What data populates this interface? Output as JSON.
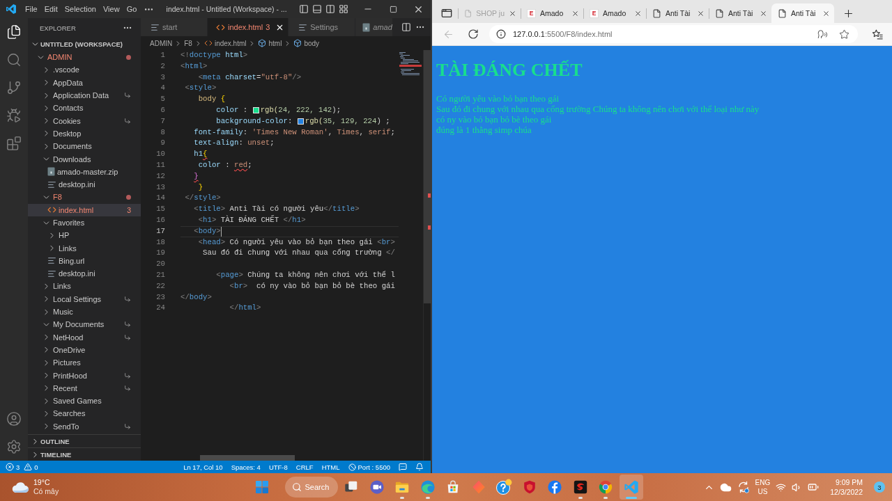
{
  "vscode": {
    "menu": [
      "File",
      "Edit",
      "Selection",
      "View",
      "Go"
    ],
    "title": "index.html - Untitled (Workspace) - ...",
    "activity_bar": [
      {
        "kind": "explorer",
        "selected": true
      },
      {
        "kind": "search",
        "selected": false
      },
      {
        "kind": "source-control",
        "selected": false
      },
      {
        "kind": "run-debug",
        "selected": false
      },
      {
        "kind": "extensions",
        "selected": false
      }
    ],
    "explorer": {
      "title": "EXPLORER",
      "workspace": {
        "label": "UNTITLED (WORKSPACE)",
        "expanded": true
      },
      "tree": [
        {
          "label": "ADMIN",
          "kind": "folder",
          "expanded": true,
          "error": true,
          "symlink": false,
          "selected": false,
          "children": [
            {
              "label": ".vscode",
              "kind": "folder",
              "expanded": false,
              "error": false,
              "symlink": false,
              "selected": false
            },
            {
              "label": "AppData",
              "kind": "folder",
              "expanded": false,
              "error": false,
              "symlink": false,
              "selected": false
            },
            {
              "label": "Application Data",
              "kind": "folder",
              "expanded": false,
              "error": false,
              "symlink": true,
              "selected": false
            },
            {
              "label": "Contacts",
              "kind": "folder",
              "expanded": false,
              "error": false,
              "symlink": false,
              "selected": false
            },
            {
              "label": "Cookies",
              "kind": "folder",
              "expanded": false,
              "error": false,
              "symlink": true,
              "selected": false
            },
            {
              "label": "Desktop",
              "kind": "folder",
              "expanded": false,
              "error": false,
              "symlink": false,
              "selected": false
            },
            {
              "label": "Documents",
              "kind": "folder",
              "expanded": false,
              "error": false,
              "symlink": false,
              "selected": false
            },
            {
              "label": "Downloads",
              "kind": "folder",
              "expanded": true,
              "error": false,
              "symlink": false,
              "selected": false,
              "children": [
                {
                  "label": "amado-master.zip",
                  "kind": "zip",
                  "error": false,
                  "symlink": false,
                  "selected": false
                },
                {
                  "label": "desktop.ini",
                  "kind": "text",
                  "error": false,
                  "symlink": false,
                  "selected": false
                }
              ]
            },
            {
              "label": "F8",
              "kind": "folder",
              "expanded": true,
              "error": true,
              "symlink": false,
              "selected": false,
              "children": [
                {
                  "label": "index.html",
                  "kind": "html",
                  "error": true,
                  "symlink": false,
                  "selected": true,
                  "problems": "3"
                }
              ]
            },
            {
              "label": "Favorites",
              "kind": "folder",
              "expanded": true,
              "error": false,
              "symlink": false,
              "selected": false,
              "children": [
                {
                  "label": "HP",
                  "kind": "folder",
                  "expanded": false,
                  "error": false,
                  "symlink": false,
                  "selected": false
                },
                {
                  "label": "Links",
                  "kind": "folder",
                  "expanded": false,
                  "error": false,
                  "symlink": false,
                  "selected": false
                },
                {
                  "label": "Bing.url",
                  "kind": "text",
                  "error": false,
                  "symlink": false,
                  "selected": false
                },
                {
                  "label": "desktop.ini",
                  "kind": "text",
                  "error": false,
                  "symlink": false,
                  "selected": false
                }
              ]
            },
            {
              "label": "Links",
              "kind": "folder",
              "expanded": false,
              "error": false,
              "symlink": false,
              "selected": false
            },
            {
              "label": "Local Settings",
              "kind": "folder",
              "expanded": false,
              "error": false,
              "symlink": true,
              "selected": false
            },
            {
              "label": "Music",
              "kind": "folder",
              "expanded": false,
              "error": false,
              "symlink": false,
              "selected": false
            },
            {
              "label": "My Documents",
              "kind": "folder",
              "expanded": true,
              "error": false,
              "symlink": true,
              "selected": false
            },
            {
              "label": "NetHood",
              "kind": "folder",
              "expanded": false,
              "error": false,
              "symlink": true,
              "selected": false
            },
            {
              "label": "OneDrive",
              "kind": "folder",
              "expanded": false,
              "error": false,
              "symlink": false,
              "selected": false
            },
            {
              "label": "Pictures",
              "kind": "folder",
              "expanded": false,
              "error": false,
              "symlink": false,
              "selected": false
            },
            {
              "label": "PrintHood",
              "kind": "folder",
              "expanded": false,
              "error": false,
              "symlink": true,
              "selected": false
            },
            {
              "label": "Recent",
              "kind": "folder",
              "expanded": false,
              "error": false,
              "symlink": true,
              "selected": false
            },
            {
              "label": "Saved Games",
              "kind": "folder",
              "expanded": false,
              "error": false,
              "symlink": false,
              "selected": false
            },
            {
              "label": "Searches",
              "kind": "folder",
              "expanded": false,
              "error": false,
              "symlink": false,
              "selected": false
            },
            {
              "label": "SendTo",
              "kind": "folder",
              "expanded": false,
              "error": false,
              "symlink": true,
              "selected": false
            }
          ]
        }
      ],
      "sections": [
        {
          "label": "OUTLINE",
          "expanded": false
        },
        {
          "label": "TIMELINE",
          "expanded": false
        }
      ]
    },
    "editor": {
      "tabs": [
        {
          "label": "start",
          "kind": "text",
          "selected": false,
          "error": false,
          "preview": false
        },
        {
          "label": "index.html",
          "kind": "html",
          "selected": true,
          "error": true,
          "preview": false,
          "problems": "3"
        },
        {
          "label": "Settings",
          "kind": "text",
          "selected": false,
          "error": false,
          "preview": false
        },
        {
          "label": "amad",
          "kind": "zip",
          "selected": false,
          "error": false,
          "preview": true
        }
      ],
      "breadcrumbs": [
        {
          "label": "ADMIN",
          "kind": "folder"
        },
        {
          "label": "F8",
          "kind": "folder"
        },
        {
          "label": "index.html",
          "kind": "html"
        },
        {
          "label": "html",
          "kind": "element"
        },
        {
          "label": "body",
          "kind": "element"
        }
      ],
      "lines": [
        {
          "number": "1",
          "active": false,
          "tokens": [
            {
              "kind": "punct",
              "text": "<!"
            },
            {
              "kind": "tag",
              "text": "doctype"
            },
            {
              "kind": "attr",
              "text": " html"
            },
            {
              "kind": "punct",
              "text": ">"
            }
          ]
        },
        {
          "number": "2",
          "active": false,
          "tokens": [
            {
              "kind": "punct",
              "text": "<"
            },
            {
              "kind": "tag",
              "text": "html"
            },
            {
              "kind": "punct",
              "text": ">"
            }
          ]
        },
        {
          "number": "3",
          "active": false,
          "tokens": [
            {
              "kind": "punct",
              "text": "    <"
            },
            {
              "kind": "tag",
              "text": "meta"
            },
            {
              "kind": "attr",
              "text": " charset"
            },
            {
              "kind": "text",
              "text": "="
            },
            {
              "kind": "string",
              "text": "\"utf-8\""
            },
            {
              "kind": "punct",
              "text": "/>"
            }
          ]
        },
        {
          "number": "4",
          "active": false,
          "tokens": [
            {
              "kind": "punct",
              "text": " <"
            },
            {
              "kind": "tag",
              "text": "style"
            },
            {
              "kind": "punct",
              "text": ">"
            }
          ]
        },
        {
          "number": "5",
          "active": false,
          "tokens": [
            {
              "kind": "selector",
              "text": "    body "
            },
            {
              "kind": "brace",
              "text": "{"
            }
          ]
        },
        {
          "number": "6",
          "active": false,
          "tokens": [
            {
              "kind": "prop",
              "text": "        color"
            },
            {
              "kind": "text",
              "text": " : "
            },
            {
              "kind": "swatch",
              "color": "#18de8e"
            },
            {
              "kind": "func",
              "text": "rgb("
            },
            {
              "kind": "number",
              "text": "24, 222, 142"
            },
            {
              "kind": "text",
              "text": ");"
            }
          ]
        },
        {
          "number": "7",
          "active": false,
          "tokens": [
            {
              "kind": "prop",
              "text": "        background-color"
            },
            {
              "kind": "text",
              "text": ": "
            },
            {
              "kind": "swatch",
              "color": "#2381e0"
            },
            {
              "kind": "func",
              "text": "rgb("
            },
            {
              "kind": "number",
              "text": "35, 129, 224"
            },
            {
              "kind": "text",
              "text": ") ;"
            }
          ]
        },
        {
          "number": "8",
          "active": false,
          "tokens": [
            {
              "kind": "prop",
              "text": "   font-family"
            },
            {
              "kind": "text",
              "text": ": "
            },
            {
              "kind": "string",
              "text": "'Times New Roman'"
            },
            {
              "kind": "text",
              "text": ", "
            },
            {
              "kind": "value",
              "text": "Times"
            },
            {
              "kind": "text",
              "text": ", "
            },
            {
              "kind": "value",
              "text": "serif"
            },
            {
              "kind": "text",
              "text": ";"
            }
          ]
        },
        {
          "number": "9",
          "active": false,
          "tokens": [
            {
              "kind": "prop",
              "text": "   text-align"
            },
            {
              "kind": "text",
              "text": ": "
            },
            {
              "kind": "value",
              "text": "unset"
            },
            {
              "kind": "text",
              "text": ";"
            }
          ]
        },
        {
          "number": "10",
          "active": false,
          "tokens": [
            {
              "kind": "prop",
              "text": "   h1"
            },
            {
              "kind": "brace-error",
              "text": "{"
            }
          ]
        },
        {
          "number": "11",
          "active": false,
          "tokens": [
            {
              "kind": "prop",
              "text": "    color"
            },
            {
              "kind": "text",
              "text": " : "
            },
            {
              "kind": "value-error",
              "text": "red"
            },
            {
              "kind": "text",
              "text": ";"
            }
          ]
        },
        {
          "number": "12",
          "active": false,
          "tokens": [
            {
              "kind": "unmatched",
              "text": "   }"
            }
          ]
        },
        {
          "number": "13",
          "active": false,
          "tokens": [
            {
              "kind": "brace",
              "text": "    }"
            }
          ]
        },
        {
          "number": "14",
          "active": false,
          "tokens": [
            {
              "kind": "punct",
              "text": " </"
            },
            {
              "kind": "tag",
              "text": "style"
            },
            {
              "kind": "punct",
              "text": ">"
            }
          ]
        },
        {
          "number": "15",
          "active": false,
          "tokens": [
            {
              "kind": "punct",
              "text": "   <"
            },
            {
              "kind": "tag",
              "text": "title"
            },
            {
              "kind": "punct",
              "text": ">"
            },
            {
              "kind": "text",
              "text": " Anti Tài có người yêu"
            },
            {
              "kind": "punct",
              "text": "</"
            },
            {
              "kind": "tag",
              "text": "title"
            },
            {
              "kind": "punct",
              "text": ">"
            }
          ]
        },
        {
          "number": "16",
          "active": false,
          "tokens": [
            {
              "kind": "punct",
              "text": "    <"
            },
            {
              "kind": "tag",
              "text": "h1"
            },
            {
              "kind": "punct",
              "text": ">"
            },
            {
              "kind": "text",
              "text": " TÀI ĐÁNG CHẾT "
            },
            {
              "kind": "punct",
              "text": "</"
            },
            {
              "kind": "tag",
              "text": "h1"
            },
            {
              "kind": "punct",
              "text": ">"
            }
          ]
        },
        {
          "number": "17",
          "active": true,
          "tokens": [
            {
              "kind": "punct",
              "text": "   <"
            },
            {
              "kind": "tag",
              "text": "body"
            },
            {
              "kind": "punct",
              "text": ">"
            }
          ]
        },
        {
          "number": "18",
          "active": false,
          "tokens": [
            {
              "kind": "punct",
              "text": "    <"
            },
            {
              "kind": "tag",
              "text": "head"
            },
            {
              "kind": "punct",
              "text": ">"
            },
            {
              "kind": "text",
              "text": " Có người yêu vào bỏ bạn theo gái "
            },
            {
              "kind": "punct",
              "text": "<"
            },
            {
              "kind": "tag",
              "text": "br"
            },
            {
              "kind": "punct",
              "text": ">"
            }
          ]
        },
        {
          "number": "19",
          "active": false,
          "tokens": [
            {
              "kind": "text",
              "text": "     Sau đó đi chung với nhau qua cổng trường "
            },
            {
              "kind": "punct",
              "text": "</"
            }
          ]
        },
        {
          "number": "20",
          "active": false
        },
        {
          "number": "21",
          "active": false,
          "tokens": [
            {
              "kind": "punct",
              "text": "        <"
            },
            {
              "kind": "tag",
              "text": "page"
            },
            {
              "kind": "punct",
              "text": ">"
            },
            {
              "kind": "text",
              "text": " Chúng ta không nên chơi với thể l"
            }
          ]
        },
        {
          "number": "22",
          "active": false,
          "tokens": [
            {
              "kind": "punct",
              "text": "           <"
            },
            {
              "kind": "tag",
              "text": "br"
            },
            {
              "kind": "punct",
              "text": ">"
            },
            {
              "kind": "text",
              "text": "  có ny vào bỏ bạn bỏ bè theo gái"
            }
          ]
        },
        {
          "number": "23",
          "active": false,
          "tokens": [
            {
              "kind": "punct",
              "text": "</"
            },
            {
              "kind": "tag",
              "text": "body"
            },
            {
              "kind": "punct",
              "text": ">"
            }
          ]
        },
        {
          "number": "24",
          "active": false,
          "tokens": [
            {
              "kind": "punct",
              "text": "           </"
            },
            {
              "kind": "tag",
              "text": "html"
            },
            {
              "kind": "punct",
              "text": ">"
            }
          ]
        }
      ]
    },
    "status_bar": {
      "errors": "3",
      "warnings": "0",
      "items": [
        "Ln 17, Col 10",
        "Spaces: 4",
        "UTF-8",
        "CRLF",
        "HTML"
      ],
      "port": "Port : 5500"
    }
  },
  "browser": {
    "tabs": [
      {
        "label": "SHOP ju",
        "kind": "page",
        "selected": false,
        "sleeping": true
      },
      {
        "label": "Amado",
        "kind": "letter",
        "favicon": "E",
        "selected": false,
        "sleeping": false
      },
      {
        "label": "Amado",
        "kind": "letter",
        "favicon": "E",
        "selected": false,
        "sleeping": false
      },
      {
        "label": "Anti Tài",
        "kind": "page",
        "selected": false,
        "sleeping": false
      },
      {
        "label": "Anti Tài",
        "kind": "page",
        "selected": false,
        "sleeping": false
      },
      {
        "label": "Anti Tài",
        "kind": "page",
        "selected": true,
        "sleeping": false
      }
    ],
    "back_button": {
      "disabled": true
    },
    "url": {
      "host": "127.0.0.1",
      "rest": ":5500/F8/index.html"
    },
    "page": {
      "heading": "TÀI ĐÁNG CHẾT",
      "lines": [
        "Có người yêu vào bỏ bạn theo gái",
        "Sau đó đi chung với nhau qua cổng trường Chúng ta không nên chơi với thể loại như này",
        "có ny vào bỏ bạn bỏ bè theo gái",
        "đúng là 1 thằng simp chúa"
      ]
    }
  },
  "taskbar": {
    "weather": {
      "temperature": "19°C",
      "condition": "Có mây"
    },
    "search": "Search",
    "apps": [
      {
        "kind": "task-view",
        "running": false,
        "active": false
      },
      {
        "kind": "video",
        "running": false,
        "active": false
      },
      {
        "kind": "folder",
        "running": true,
        "active": false
      },
      {
        "kind": "edge",
        "running": true,
        "active": false
      },
      {
        "kind": "store",
        "running": false,
        "active": false
      },
      {
        "kind": "diamond",
        "running": false,
        "active": false
      },
      {
        "kind": "help",
        "running": false,
        "active": false
      },
      {
        "kind": "shield",
        "running": false,
        "active": false
      },
      {
        "kind": "facebook",
        "running": false,
        "active": false
      },
      {
        "kind": "game",
        "running": true,
        "active": false
      },
      {
        "kind": "chrome",
        "running": true,
        "active": false
      },
      {
        "kind": "vscode",
        "running": true,
        "active": true
      }
    ],
    "tray": {
      "language": "ENG",
      "region": "US",
      "time": "9:09 PM",
      "date": "12/3/2022",
      "notifications": "3"
    }
  }
}
